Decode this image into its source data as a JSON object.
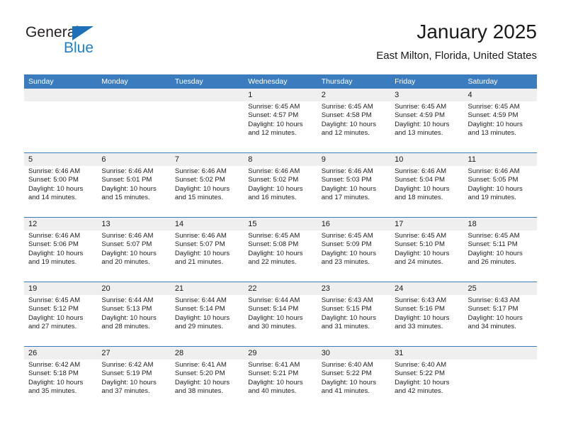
{
  "brand": {
    "name_part1": "General",
    "name_part2": "Blue",
    "triangle_color": "#1d6fb8",
    "blue_color": "#1d7fd1"
  },
  "header": {
    "title": "January 2025",
    "location": "East Milton, Florida, United States",
    "weekday_header_color": "#3b7cbf",
    "daynum_band_color": "#efefef"
  },
  "weekdays": [
    "Sunday",
    "Monday",
    "Tuesday",
    "Wednesday",
    "Thursday",
    "Friday",
    "Saturday"
  ],
  "weeks": [
    [
      {
        "day": "",
        "sunrise": "",
        "sunset": "",
        "daylight1": "",
        "daylight2": ""
      },
      {
        "day": "",
        "sunrise": "",
        "sunset": "",
        "daylight1": "",
        "daylight2": ""
      },
      {
        "day": "",
        "sunrise": "",
        "sunset": "",
        "daylight1": "",
        "daylight2": ""
      },
      {
        "day": "1",
        "sunrise": "Sunrise: 6:45 AM",
        "sunset": "Sunset: 4:57 PM",
        "daylight1": "Daylight: 10 hours",
        "daylight2": "and 12 minutes."
      },
      {
        "day": "2",
        "sunrise": "Sunrise: 6:45 AM",
        "sunset": "Sunset: 4:58 PM",
        "daylight1": "Daylight: 10 hours",
        "daylight2": "and 12 minutes."
      },
      {
        "day": "3",
        "sunrise": "Sunrise: 6:45 AM",
        "sunset": "Sunset: 4:59 PM",
        "daylight1": "Daylight: 10 hours",
        "daylight2": "and 13 minutes."
      },
      {
        "day": "4",
        "sunrise": "Sunrise: 6:45 AM",
        "sunset": "Sunset: 4:59 PM",
        "daylight1": "Daylight: 10 hours",
        "daylight2": "and 13 minutes."
      }
    ],
    [
      {
        "day": "5",
        "sunrise": "Sunrise: 6:46 AM",
        "sunset": "Sunset: 5:00 PM",
        "daylight1": "Daylight: 10 hours",
        "daylight2": "and 14 minutes."
      },
      {
        "day": "6",
        "sunrise": "Sunrise: 6:46 AM",
        "sunset": "Sunset: 5:01 PM",
        "daylight1": "Daylight: 10 hours",
        "daylight2": "and 15 minutes."
      },
      {
        "day": "7",
        "sunrise": "Sunrise: 6:46 AM",
        "sunset": "Sunset: 5:02 PM",
        "daylight1": "Daylight: 10 hours",
        "daylight2": "and 15 minutes."
      },
      {
        "day": "8",
        "sunrise": "Sunrise: 6:46 AM",
        "sunset": "Sunset: 5:02 PM",
        "daylight1": "Daylight: 10 hours",
        "daylight2": "and 16 minutes."
      },
      {
        "day": "9",
        "sunrise": "Sunrise: 6:46 AM",
        "sunset": "Sunset: 5:03 PM",
        "daylight1": "Daylight: 10 hours",
        "daylight2": "and 17 minutes."
      },
      {
        "day": "10",
        "sunrise": "Sunrise: 6:46 AM",
        "sunset": "Sunset: 5:04 PM",
        "daylight1": "Daylight: 10 hours",
        "daylight2": "and 18 minutes."
      },
      {
        "day": "11",
        "sunrise": "Sunrise: 6:46 AM",
        "sunset": "Sunset: 5:05 PM",
        "daylight1": "Daylight: 10 hours",
        "daylight2": "and 19 minutes."
      }
    ],
    [
      {
        "day": "12",
        "sunrise": "Sunrise: 6:46 AM",
        "sunset": "Sunset: 5:06 PM",
        "daylight1": "Daylight: 10 hours",
        "daylight2": "and 19 minutes."
      },
      {
        "day": "13",
        "sunrise": "Sunrise: 6:46 AM",
        "sunset": "Sunset: 5:07 PM",
        "daylight1": "Daylight: 10 hours",
        "daylight2": "and 20 minutes."
      },
      {
        "day": "14",
        "sunrise": "Sunrise: 6:46 AM",
        "sunset": "Sunset: 5:07 PM",
        "daylight1": "Daylight: 10 hours",
        "daylight2": "and 21 minutes."
      },
      {
        "day": "15",
        "sunrise": "Sunrise: 6:45 AM",
        "sunset": "Sunset: 5:08 PM",
        "daylight1": "Daylight: 10 hours",
        "daylight2": "and 22 minutes."
      },
      {
        "day": "16",
        "sunrise": "Sunrise: 6:45 AM",
        "sunset": "Sunset: 5:09 PM",
        "daylight1": "Daylight: 10 hours",
        "daylight2": "and 23 minutes."
      },
      {
        "day": "17",
        "sunrise": "Sunrise: 6:45 AM",
        "sunset": "Sunset: 5:10 PM",
        "daylight1": "Daylight: 10 hours",
        "daylight2": "and 24 minutes."
      },
      {
        "day": "18",
        "sunrise": "Sunrise: 6:45 AM",
        "sunset": "Sunset: 5:11 PM",
        "daylight1": "Daylight: 10 hours",
        "daylight2": "and 26 minutes."
      }
    ],
    [
      {
        "day": "19",
        "sunrise": "Sunrise: 6:45 AM",
        "sunset": "Sunset: 5:12 PM",
        "daylight1": "Daylight: 10 hours",
        "daylight2": "and 27 minutes."
      },
      {
        "day": "20",
        "sunrise": "Sunrise: 6:44 AM",
        "sunset": "Sunset: 5:13 PM",
        "daylight1": "Daylight: 10 hours",
        "daylight2": "and 28 minutes."
      },
      {
        "day": "21",
        "sunrise": "Sunrise: 6:44 AM",
        "sunset": "Sunset: 5:14 PM",
        "daylight1": "Daylight: 10 hours",
        "daylight2": "and 29 minutes."
      },
      {
        "day": "22",
        "sunrise": "Sunrise: 6:44 AM",
        "sunset": "Sunset: 5:14 PM",
        "daylight1": "Daylight: 10 hours",
        "daylight2": "and 30 minutes."
      },
      {
        "day": "23",
        "sunrise": "Sunrise: 6:43 AM",
        "sunset": "Sunset: 5:15 PM",
        "daylight1": "Daylight: 10 hours",
        "daylight2": "and 31 minutes."
      },
      {
        "day": "24",
        "sunrise": "Sunrise: 6:43 AM",
        "sunset": "Sunset: 5:16 PM",
        "daylight1": "Daylight: 10 hours",
        "daylight2": "and 33 minutes."
      },
      {
        "day": "25",
        "sunrise": "Sunrise: 6:43 AM",
        "sunset": "Sunset: 5:17 PM",
        "daylight1": "Daylight: 10 hours",
        "daylight2": "and 34 minutes."
      }
    ],
    [
      {
        "day": "26",
        "sunrise": "Sunrise: 6:42 AM",
        "sunset": "Sunset: 5:18 PM",
        "daylight1": "Daylight: 10 hours",
        "daylight2": "and 35 minutes."
      },
      {
        "day": "27",
        "sunrise": "Sunrise: 6:42 AM",
        "sunset": "Sunset: 5:19 PM",
        "daylight1": "Daylight: 10 hours",
        "daylight2": "and 37 minutes."
      },
      {
        "day": "28",
        "sunrise": "Sunrise: 6:41 AM",
        "sunset": "Sunset: 5:20 PM",
        "daylight1": "Daylight: 10 hours",
        "daylight2": "and 38 minutes."
      },
      {
        "day": "29",
        "sunrise": "Sunrise: 6:41 AM",
        "sunset": "Sunset: 5:21 PM",
        "daylight1": "Daylight: 10 hours",
        "daylight2": "and 40 minutes."
      },
      {
        "day": "30",
        "sunrise": "Sunrise: 6:40 AM",
        "sunset": "Sunset: 5:22 PM",
        "daylight1": "Daylight: 10 hours",
        "daylight2": "and 41 minutes."
      },
      {
        "day": "31",
        "sunrise": "Sunrise: 6:40 AM",
        "sunset": "Sunset: 5:22 PM",
        "daylight1": "Daylight: 10 hours",
        "daylight2": "and 42 minutes."
      },
      {
        "day": "",
        "sunrise": "",
        "sunset": "",
        "daylight1": "",
        "daylight2": ""
      }
    ]
  ]
}
